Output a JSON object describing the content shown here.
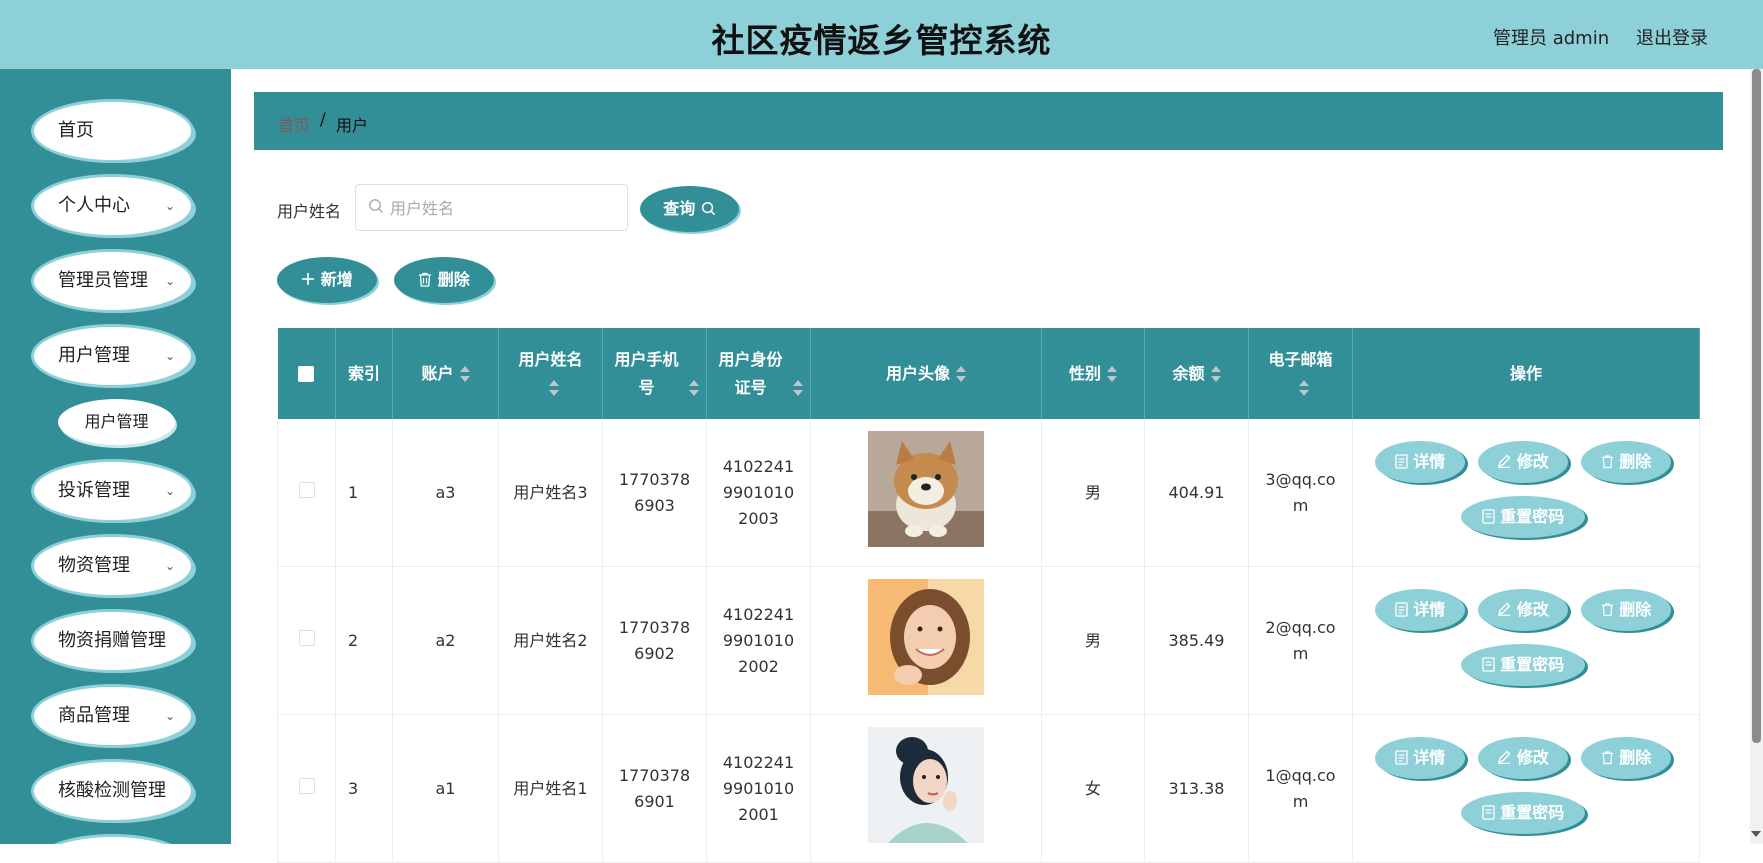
{
  "header": {
    "title": "社区疫情返乡管控系统",
    "user_label": "管理员 admin",
    "logout_label": "退出登录"
  },
  "sidebar": {
    "items": [
      {
        "label": "首页",
        "has_chevron": false
      },
      {
        "label": "个人中心",
        "has_chevron": true
      },
      {
        "label": "管理员管理",
        "has_chevron": true
      },
      {
        "label": "用户管理",
        "has_chevron": true
      },
      {
        "label": "投诉管理",
        "has_chevron": true
      },
      {
        "label": "物资管理",
        "has_chevron": true
      },
      {
        "label": "物资捐赠管理",
        "has_chevron": true
      },
      {
        "label": "商品管理",
        "has_chevron": true
      },
      {
        "label": "核酸检测管理",
        "has_chevron": true
      }
    ],
    "submenu": {
      "label": "用户管理"
    }
  },
  "breadcrumb": {
    "home": "首页",
    "separator": "/",
    "current": "用户"
  },
  "search": {
    "label": "用户姓名",
    "placeholder": "用户姓名",
    "value": "",
    "query_button": "查询"
  },
  "toolbar": {
    "add_label": "新增",
    "delete_label": "删除"
  },
  "table": {
    "headers": {
      "index": "索引",
      "account": "账户",
      "name": "用户姓名",
      "phone": "用户手机号",
      "id_card": "用户身份证号",
      "avatar": "用户头像",
      "gender": "性别",
      "balance": "余额",
      "email": "电子邮箱",
      "actions": "操作"
    },
    "rows": [
      {
        "index": "1",
        "account": "a3",
        "name": "用户姓名3",
        "phone": "17703786903",
        "id_card": "410224199010102003",
        "avatar": "shiba-dog-photo",
        "gender": "男",
        "balance": "404.91",
        "email": "3@qq.com"
      },
      {
        "index": "2",
        "account": "a2",
        "name": "用户姓名2",
        "phone": "17703786902",
        "id_card": "410224199010102002",
        "avatar": "smiling-woman-photo",
        "gender": "男",
        "balance": "385.49",
        "email": "2@qq.com"
      },
      {
        "index": "3",
        "account": "a1",
        "name": "用户姓名1",
        "phone": "17703786901",
        "id_card": "410224199010102001",
        "avatar": "woman-updo-photo",
        "gender": "女",
        "balance": "313.38",
        "email": "1@qq.com"
      }
    ],
    "row_actions": {
      "detail": "详情",
      "edit": "修改",
      "delete": "删除",
      "reset_password": "重置密码"
    }
  },
  "colors": {
    "header_bg": "#8ed0d8",
    "primary": "#338f97",
    "light_accent": "#8ed0d8"
  }
}
